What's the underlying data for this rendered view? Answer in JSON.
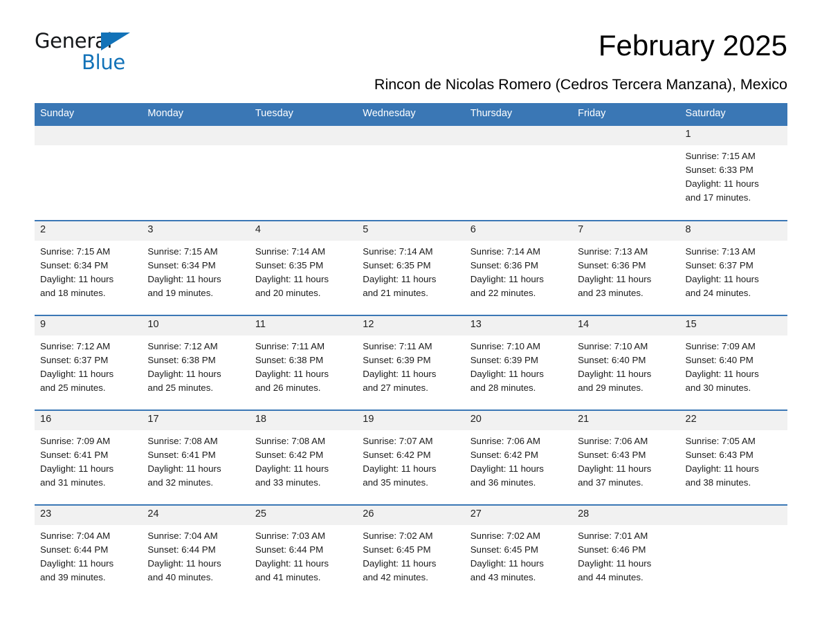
{
  "brand": {
    "name_part1": "General",
    "name_part2": "Blue",
    "triangle_color": "#1272b8"
  },
  "header": {
    "month_title": "February 2025",
    "location": "Rincon de Nicolas Romero (Cedros Tercera Manzana), Mexico",
    "accent_color": "#3a77b5"
  },
  "weekday_headers": [
    "Sunday",
    "Monday",
    "Tuesday",
    "Wednesday",
    "Thursday",
    "Friday",
    "Saturday"
  ],
  "labels": {
    "sunrise_prefix": "Sunrise:",
    "sunset_prefix": "Sunset:",
    "daylight_prefix": "Daylight:"
  },
  "weeks": [
    [
      {
        "day": "",
        "empty": true
      },
      {
        "day": "",
        "empty": true
      },
      {
        "day": "",
        "empty": true
      },
      {
        "day": "",
        "empty": true
      },
      {
        "day": "",
        "empty": true
      },
      {
        "day": "",
        "empty": true
      },
      {
        "day": "1",
        "sunrise": "Sunrise: 7:15 AM",
        "sunset": "Sunset: 6:33 PM",
        "daylight1": "Daylight: 11 hours",
        "daylight2": "and 17 minutes."
      }
    ],
    [
      {
        "day": "2",
        "sunrise": "Sunrise: 7:15 AM",
        "sunset": "Sunset: 6:34 PM",
        "daylight1": "Daylight: 11 hours",
        "daylight2": "and 18 minutes."
      },
      {
        "day": "3",
        "sunrise": "Sunrise: 7:15 AM",
        "sunset": "Sunset: 6:34 PM",
        "daylight1": "Daylight: 11 hours",
        "daylight2": "and 19 minutes."
      },
      {
        "day": "4",
        "sunrise": "Sunrise: 7:14 AM",
        "sunset": "Sunset: 6:35 PM",
        "daylight1": "Daylight: 11 hours",
        "daylight2": "and 20 minutes."
      },
      {
        "day": "5",
        "sunrise": "Sunrise: 7:14 AM",
        "sunset": "Sunset: 6:35 PM",
        "daylight1": "Daylight: 11 hours",
        "daylight2": "and 21 minutes."
      },
      {
        "day": "6",
        "sunrise": "Sunrise: 7:14 AM",
        "sunset": "Sunset: 6:36 PM",
        "daylight1": "Daylight: 11 hours",
        "daylight2": "and 22 minutes."
      },
      {
        "day": "7",
        "sunrise": "Sunrise: 7:13 AM",
        "sunset": "Sunset: 6:36 PM",
        "daylight1": "Daylight: 11 hours",
        "daylight2": "and 23 minutes."
      },
      {
        "day": "8",
        "sunrise": "Sunrise: 7:13 AM",
        "sunset": "Sunset: 6:37 PM",
        "daylight1": "Daylight: 11 hours",
        "daylight2": "and 24 minutes."
      }
    ],
    [
      {
        "day": "9",
        "sunrise": "Sunrise: 7:12 AM",
        "sunset": "Sunset: 6:37 PM",
        "daylight1": "Daylight: 11 hours",
        "daylight2": "and 25 minutes."
      },
      {
        "day": "10",
        "sunrise": "Sunrise: 7:12 AM",
        "sunset": "Sunset: 6:38 PM",
        "daylight1": "Daylight: 11 hours",
        "daylight2": "and 25 minutes."
      },
      {
        "day": "11",
        "sunrise": "Sunrise: 7:11 AM",
        "sunset": "Sunset: 6:38 PM",
        "daylight1": "Daylight: 11 hours",
        "daylight2": "and 26 minutes."
      },
      {
        "day": "12",
        "sunrise": "Sunrise: 7:11 AM",
        "sunset": "Sunset: 6:39 PM",
        "daylight1": "Daylight: 11 hours",
        "daylight2": "and 27 minutes."
      },
      {
        "day": "13",
        "sunrise": "Sunrise: 7:10 AM",
        "sunset": "Sunset: 6:39 PM",
        "daylight1": "Daylight: 11 hours",
        "daylight2": "and 28 minutes."
      },
      {
        "day": "14",
        "sunrise": "Sunrise: 7:10 AM",
        "sunset": "Sunset: 6:40 PM",
        "daylight1": "Daylight: 11 hours",
        "daylight2": "and 29 minutes."
      },
      {
        "day": "15",
        "sunrise": "Sunrise: 7:09 AM",
        "sunset": "Sunset: 6:40 PM",
        "daylight1": "Daylight: 11 hours",
        "daylight2": "and 30 minutes."
      }
    ],
    [
      {
        "day": "16",
        "sunrise": "Sunrise: 7:09 AM",
        "sunset": "Sunset: 6:41 PM",
        "daylight1": "Daylight: 11 hours",
        "daylight2": "and 31 minutes."
      },
      {
        "day": "17",
        "sunrise": "Sunrise: 7:08 AM",
        "sunset": "Sunset: 6:41 PM",
        "daylight1": "Daylight: 11 hours",
        "daylight2": "and 32 minutes."
      },
      {
        "day": "18",
        "sunrise": "Sunrise: 7:08 AM",
        "sunset": "Sunset: 6:42 PM",
        "daylight1": "Daylight: 11 hours",
        "daylight2": "and 33 minutes."
      },
      {
        "day": "19",
        "sunrise": "Sunrise: 7:07 AM",
        "sunset": "Sunset: 6:42 PM",
        "daylight1": "Daylight: 11 hours",
        "daylight2": "and 35 minutes."
      },
      {
        "day": "20",
        "sunrise": "Sunrise: 7:06 AM",
        "sunset": "Sunset: 6:42 PM",
        "daylight1": "Daylight: 11 hours",
        "daylight2": "and 36 minutes."
      },
      {
        "day": "21",
        "sunrise": "Sunrise: 7:06 AM",
        "sunset": "Sunset: 6:43 PM",
        "daylight1": "Daylight: 11 hours",
        "daylight2": "and 37 minutes."
      },
      {
        "day": "22",
        "sunrise": "Sunrise: 7:05 AM",
        "sunset": "Sunset: 6:43 PM",
        "daylight1": "Daylight: 11 hours",
        "daylight2": "and 38 minutes."
      }
    ],
    [
      {
        "day": "23",
        "sunrise": "Sunrise: 7:04 AM",
        "sunset": "Sunset: 6:44 PM",
        "daylight1": "Daylight: 11 hours",
        "daylight2": "and 39 minutes."
      },
      {
        "day": "24",
        "sunrise": "Sunrise: 7:04 AM",
        "sunset": "Sunset: 6:44 PM",
        "daylight1": "Daylight: 11 hours",
        "daylight2": "and 40 minutes."
      },
      {
        "day": "25",
        "sunrise": "Sunrise: 7:03 AM",
        "sunset": "Sunset: 6:44 PM",
        "daylight1": "Daylight: 11 hours",
        "daylight2": "and 41 minutes."
      },
      {
        "day": "26",
        "sunrise": "Sunrise: 7:02 AM",
        "sunset": "Sunset: 6:45 PM",
        "daylight1": "Daylight: 11 hours",
        "daylight2": "and 42 minutes."
      },
      {
        "day": "27",
        "sunrise": "Sunrise: 7:02 AM",
        "sunset": "Sunset: 6:45 PM",
        "daylight1": "Daylight: 11 hours",
        "daylight2": "and 43 minutes."
      },
      {
        "day": "28",
        "sunrise": "Sunrise: 7:01 AM",
        "sunset": "Sunset: 6:46 PM",
        "daylight1": "Daylight: 11 hours",
        "daylight2": "and 44 minutes."
      },
      {
        "day": "",
        "empty": true
      }
    ]
  ]
}
